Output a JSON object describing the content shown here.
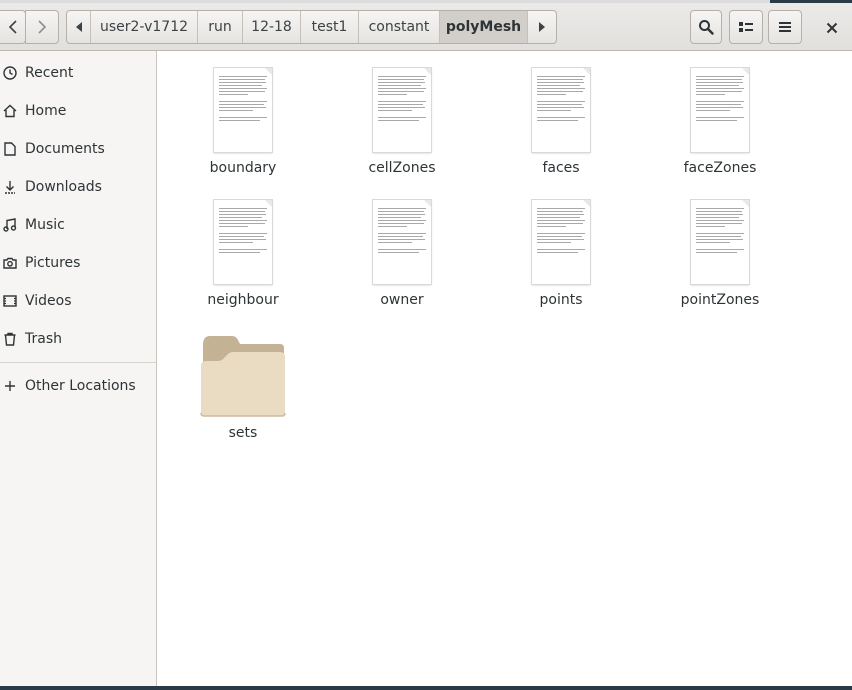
{
  "header": {
    "breadcrumbs": [
      "user2-v1712",
      "run",
      "12-18",
      "test1",
      "constant",
      "polyMesh"
    ],
    "active_crumb": "polyMesh"
  },
  "icons": {
    "back": "chevron-left-icon",
    "forward": "chevron-right-icon",
    "path_left": "triangle-left-icon",
    "path_right": "triangle-right-icon",
    "search": "search-icon",
    "view": "list-view-icon",
    "menu": "hamburger-menu-icon",
    "close": "close-icon"
  },
  "sidebar": {
    "items": [
      {
        "label": "Recent",
        "icon": "clock-icon"
      },
      {
        "label": "Home",
        "icon": "home-icon"
      },
      {
        "label": "Documents",
        "icon": "document-icon"
      },
      {
        "label": "Downloads",
        "icon": "download-icon"
      },
      {
        "label": "Music",
        "icon": "music-icon"
      },
      {
        "label": "Pictures",
        "icon": "camera-icon"
      },
      {
        "label": "Videos",
        "icon": "video-icon"
      },
      {
        "label": "Trash",
        "icon": "trash-icon"
      }
    ],
    "other": {
      "label": "Other Locations",
      "icon": "plus-icon"
    }
  },
  "files": [
    {
      "name": "boundary",
      "type": "text-file"
    },
    {
      "name": "cellZones",
      "type": "text-file"
    },
    {
      "name": "faces",
      "type": "text-file"
    },
    {
      "name": "faceZones",
      "type": "text-file"
    },
    {
      "name": "neighbour",
      "type": "text-file"
    },
    {
      "name": "owner",
      "type": "text-file"
    },
    {
      "name": "points",
      "type": "text-file"
    },
    {
      "name": "pointZones",
      "type": "text-file"
    },
    {
      "name": "sets",
      "type": "folder"
    }
  ],
  "colors": {
    "header_bg": "#e2e0dd",
    "sidebar_bg": "#f6f5f4",
    "folder_front": "#eadbc3",
    "folder_back": "#c4b294"
  }
}
